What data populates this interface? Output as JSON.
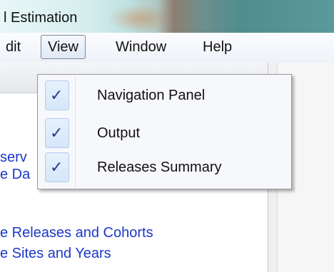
{
  "window": {
    "title": "l Estimation"
  },
  "menubar": {
    "edit": "dit",
    "view": "View",
    "window": "Window",
    "help": "Help"
  },
  "view_menu": {
    "items": [
      {
        "label": "Navigation Panel",
        "checked": true,
        "check_glyph": "✓"
      },
      {
        "label": "Output",
        "checked": true,
        "check_glyph": "✓"
      },
      {
        "label": "Releases Summary",
        "checked": true,
        "check_glyph": "✓"
      }
    ]
  },
  "nav_panel": {
    "links": [
      "serv",
      "e Da",
      "e Releases and Cohorts",
      "e Sites and Years"
    ]
  },
  "colors": {
    "link": "#1a38c8",
    "check": "#2a3a8a",
    "checkbox_border": "#b4cdee"
  }
}
